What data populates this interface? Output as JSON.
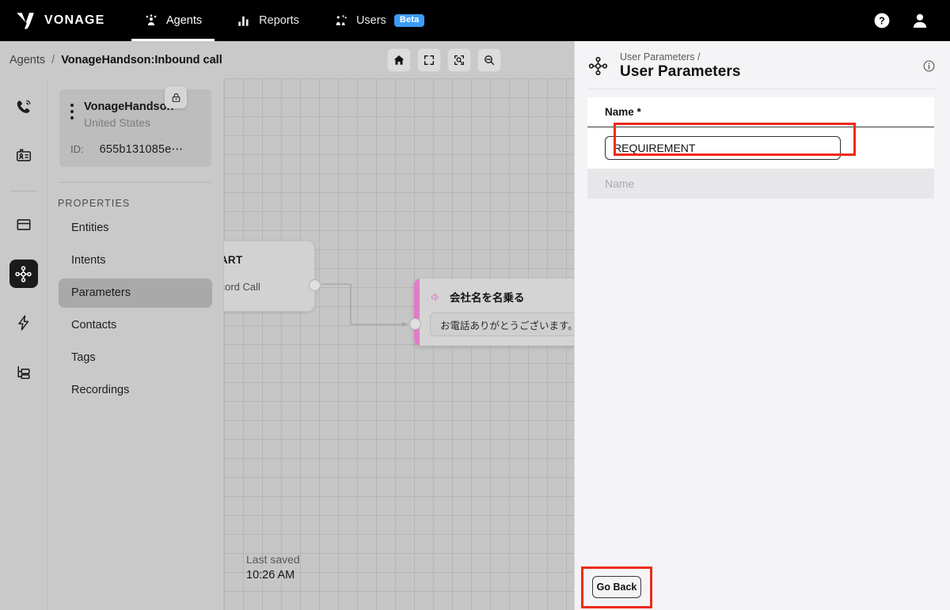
{
  "topnav": {
    "brand": "VONAGE",
    "brand_logo_icon": "vonage-v-logo",
    "tabs": [
      {
        "label": "Agents",
        "icon": "agents-icon",
        "active": true
      },
      {
        "label": "Reports",
        "icon": "bar-chart-icon",
        "active": false
      },
      {
        "label": "Users",
        "icon": "users-icon",
        "active": false,
        "badge": "Beta"
      }
    ],
    "help_icon": "help-circle-icon",
    "account_icon": "user-avatar-icon",
    "badge_color": "#3b9cf8"
  },
  "breadcrumb": {
    "root": "Agents",
    "separator": "/",
    "current": "VonageHandson:Inbound call"
  },
  "toolbar": {
    "buttons": [
      {
        "name": "home-button",
        "icon": "home-icon"
      },
      {
        "name": "fit-screen-button",
        "icon": "fit-screen-icon"
      },
      {
        "name": "zoom-to-fit-button",
        "icon": "zoom-target-icon"
      },
      {
        "name": "zoom-out-button",
        "icon": "zoom-out-icon"
      }
    ]
  },
  "rail": {
    "items": [
      {
        "name": "sidebar-item-calls",
        "icon": "phone-ring-icon",
        "active": false
      },
      {
        "name": "sidebar-item-contacts",
        "icon": "id-card-icon",
        "active": false
      },
      {
        "name": "sidebar-item-panels",
        "icon": "window-panel-icon",
        "active": false
      },
      {
        "name": "sidebar-item-parameters",
        "icon": "node-hub-icon",
        "active": true
      },
      {
        "name": "sidebar-item-actions",
        "icon": "lightning-bolt-icon",
        "active": false
      },
      {
        "name": "sidebar-item-hierarchy",
        "icon": "hierarchy-icon",
        "active": false
      }
    ]
  },
  "agent_card": {
    "name": "VonageHandson",
    "country": "United States",
    "id_label": "ID:",
    "id_value": "655b131085e⋯",
    "menu_icon": "kebab-menu-icon",
    "lock_icon": "lock-icon"
  },
  "properties": {
    "title": "PROPERTIES",
    "items": [
      {
        "label": "Entities",
        "active": false
      },
      {
        "label": "Intents",
        "active": false
      },
      {
        "label": "Parameters",
        "active": true
      },
      {
        "label": "Contacts",
        "active": false
      },
      {
        "label": "Tags",
        "active": false
      },
      {
        "label": "Recordings",
        "active": false
      }
    ]
  },
  "canvas": {
    "start_node": {
      "title": "START",
      "subtitle": "Record Call"
    },
    "speak_node": {
      "title": "会社名を名乗る",
      "icon": "speaker-icon",
      "message": "お電話ありがとうございます。⋯",
      "accent_color": "#e07cc8"
    },
    "last_saved_label": "Last saved",
    "last_saved_time": "10:26 AM"
  },
  "right_panel": {
    "icon": "node-hub-icon",
    "breadcrumb": "User Parameters  /",
    "title": "User Parameters",
    "info_icon": "info-circle-icon",
    "table": {
      "header": "Name *",
      "input_value": "REQUIREMENT",
      "input_placeholder": "Name",
      "ghost_row_placeholder": "Name"
    },
    "go_back_label": "Go Back",
    "annotation_color": "#ef2a16"
  }
}
